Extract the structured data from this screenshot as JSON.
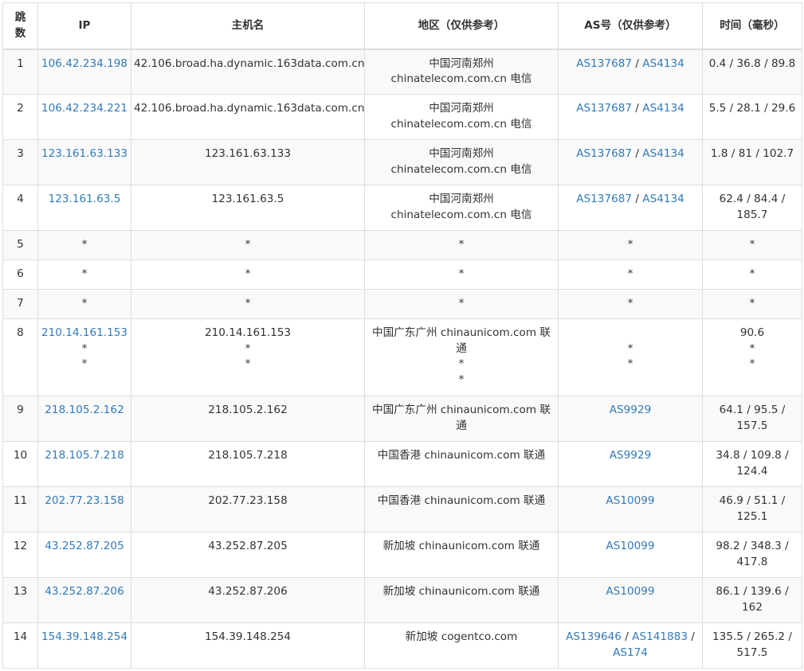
{
  "headers": {
    "hop": "跳数",
    "ip": "IP",
    "host": "主机名",
    "region": "地区（仅供参考）",
    "as": "AS号（仅供参考）",
    "time": "时间（毫秒）"
  },
  "rows": [
    {
      "hop": "1",
      "ip": [
        "106.42.234.198"
      ],
      "host": [
        "42.106.broad.ha.dynamic.163data.com.cn"
      ],
      "region": [
        "中国河南郑州",
        "chinatelecom.com.cn 电信"
      ],
      "as": [
        [
          "AS137687",
          " / ",
          "AS4134"
        ]
      ],
      "time": [
        "0.4 / 36.8 / 89.8"
      ]
    },
    {
      "hop": "2",
      "ip": [
        "106.42.234.221"
      ],
      "host": [
        "42.106.broad.ha.dynamic.163data.com.cn"
      ],
      "region": [
        "中国河南郑州",
        "chinatelecom.com.cn 电信"
      ],
      "as": [
        [
          "AS137687",
          " / ",
          "AS4134"
        ]
      ],
      "time": [
        "5.5 / 28.1 / 29.6"
      ]
    },
    {
      "hop": "3",
      "ip": [
        "123.161.63.133"
      ],
      "host": [
        "123.161.63.133"
      ],
      "region": [
        "中国河南郑州",
        "chinatelecom.com.cn 电信"
      ],
      "as": [
        [
          "AS137687",
          " / ",
          "AS4134"
        ]
      ],
      "time": [
        "1.8 / 81 / 102.7"
      ]
    },
    {
      "hop": "4",
      "ip": [
        "123.161.63.5"
      ],
      "host": [
        "123.161.63.5"
      ],
      "region": [
        "中国河南郑州",
        "chinatelecom.com.cn 电信"
      ],
      "as": [
        [
          "AS137687",
          " / ",
          "AS4134"
        ]
      ],
      "time": [
        "62.4 / 84.4 /",
        "185.7"
      ]
    },
    {
      "hop": "5",
      "ip": [
        "*"
      ],
      "host": [
        "*"
      ],
      "region": [
        "*"
      ],
      "as": [
        [
          "*"
        ]
      ],
      "time": [
        "*"
      ]
    },
    {
      "hop": "6",
      "ip": [
        "*"
      ],
      "host": [
        "*"
      ],
      "region": [
        "*"
      ],
      "as": [
        [
          "*"
        ]
      ],
      "time": [
        "*"
      ]
    },
    {
      "hop": "7",
      "ip": [
        "*"
      ],
      "host": [
        "*"
      ],
      "region": [
        "*"
      ],
      "as": [
        [
          "*"
        ]
      ],
      "time": [
        "*"
      ]
    },
    {
      "hop": "8",
      "ip": [
        "210.14.161.153",
        "*",
        "*"
      ],
      "host": [
        "210.14.161.153",
        "*",
        "*"
      ],
      "region": [
        "中国广东广州 chinaunicom.com 联",
        "通",
        "*",
        "*"
      ],
      "as": [
        [
          ""
        ],
        [
          "*"
        ],
        [
          "*"
        ]
      ],
      "time": [
        "90.6",
        "*",
        "*"
      ]
    },
    {
      "hop": "9",
      "ip": [
        "218.105.2.162"
      ],
      "host": [
        "218.105.2.162"
      ],
      "region": [
        "中国广东广州 chinaunicom.com 联",
        "通"
      ],
      "as": [
        [
          "AS9929"
        ]
      ],
      "time": [
        "64.1 / 95.5 /",
        "157.5"
      ]
    },
    {
      "hop": "10",
      "ip": [
        "218.105.7.218"
      ],
      "host": [
        "218.105.7.218"
      ],
      "region": [
        "中国香港 chinaunicom.com 联通"
      ],
      "as": [
        [
          "AS9929"
        ]
      ],
      "time": [
        "34.8 / 109.8 /",
        "124.4"
      ]
    },
    {
      "hop": "11",
      "ip": [
        "202.77.23.158"
      ],
      "host": [
        "202.77.23.158"
      ],
      "region": [
        "中国香港 chinaunicom.com 联通"
      ],
      "as": [
        [
          "AS10099"
        ]
      ],
      "time": [
        "46.9 / 51.1 /",
        "125.1"
      ]
    },
    {
      "hop": "12",
      "ip": [
        "43.252.87.205"
      ],
      "host": [
        "43.252.87.205"
      ],
      "region": [
        "新加坡 chinaunicom.com 联通"
      ],
      "as": [
        [
          "AS10099"
        ]
      ],
      "time": [
        "98.2 / 348.3 /",
        "417.8"
      ]
    },
    {
      "hop": "13",
      "ip": [
        "43.252.87.206"
      ],
      "host": [
        "43.252.87.206"
      ],
      "region": [
        "新加坡 chinaunicom.com 联通"
      ],
      "as": [
        [
          "AS10099"
        ]
      ],
      "time": [
        "86.1 / 139.6 /",
        "162"
      ]
    },
    {
      "hop": "14",
      "ip": [
        "154.39.148.254"
      ],
      "host": [
        "154.39.148.254"
      ],
      "region": [
        "新加坡 cogentco.com"
      ],
      "as": [
        [
          "AS139646",
          " / ",
          "AS141883",
          " /"
        ],
        [
          "AS174"
        ]
      ],
      "time": [
        "135.5 / 265.2 /",
        "517.5"
      ]
    }
  ],
  "colors": {
    "link": "#337ab7",
    "text": "#333333",
    "stripe": "#f9f9f9",
    "border": "#dddddd"
  }
}
